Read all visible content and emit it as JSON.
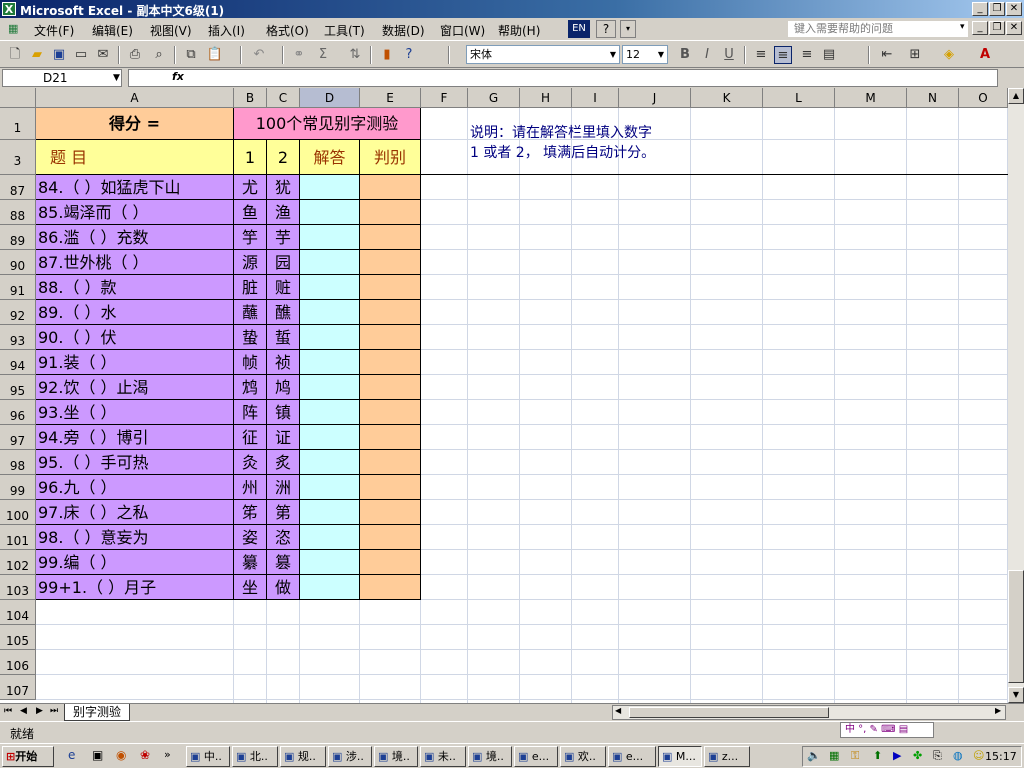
{
  "window": {
    "title": "Microsoft Excel - 副本中文6级(1)",
    "min": "_",
    "restore": "❐",
    "close": "✕"
  },
  "menu": {
    "items": [
      "文件(F)",
      "编辑(E)",
      "视图(V)",
      "插入(I)",
      "格式(O)",
      "工具(T)",
      "数据(D)",
      "窗口(W)",
      "帮助(H)"
    ],
    "lang": "EN",
    "help_placeholder": "键入需要帮助的问题"
  },
  "toolbar": {
    "font": "宋体",
    "size": "12",
    "bold": "B",
    "italic": "I",
    "underline": "U",
    "sum": "Σ"
  },
  "formula": {
    "namebox": "D21",
    "fx": "fx",
    "value": ""
  },
  "columns": [
    "A",
    "B",
    "C",
    "D",
    "E",
    "F",
    "G",
    "H",
    "I",
    "J",
    "K",
    "L",
    "M",
    "N",
    "O"
  ],
  "header": {
    "score_label": "得分 =",
    "test_title": "100个常见别字测验",
    "instr_line1": "说明：请在解答栏里填入数字",
    "instr_line2": "1 或者 2， 填满后自动计分。",
    "col_q": "题 目",
    "col_1": "1",
    "col_2": "2",
    "col_ans": "解答",
    "col_judge": "判别",
    "row1": "1",
    "row3": "3"
  },
  "rows": [
    {
      "n": "87",
      "q": "84.（ ）如猛虎下山",
      "c1": "尤",
      "c2": "犹"
    },
    {
      "n": "88",
      "q": "85.竭泽而（ ）",
      "c1": "鱼",
      "c2": "渔"
    },
    {
      "n": "89",
      "q": "86.滥（ ）充数",
      "c1": "竽",
      "c2": "芋"
    },
    {
      "n": "90",
      "q": "87.世外桃（ ）",
      "c1": "源",
      "c2": "园"
    },
    {
      "n": "91",
      "q": "88.（ ）款",
      "c1": "脏",
      "c2": "赃"
    },
    {
      "n": "92",
      "q": "89.（ ）水",
      "c1": "蘸",
      "c2": "醮"
    },
    {
      "n": "93",
      "q": "90.（ ）伏",
      "c1": "蛰",
      "c2": "蜇"
    },
    {
      "n": "94",
      "q": "91.装（ ）",
      "c1": "帧",
      "c2": "祯"
    },
    {
      "n": "95",
      "q": "92.饮（ ）止渴",
      "c1": "鸩",
      "c2": "鸠"
    },
    {
      "n": "96",
      "q": "93.坐（ ）",
      "c1": "阵",
      "c2": "镇"
    },
    {
      "n": "97",
      "q": "94.旁（ ）博引",
      "c1": "征",
      "c2": "证"
    },
    {
      "n": "98",
      "q": "95.（ ）手可热",
      "c1": "灸",
      "c2": "炙"
    },
    {
      "n": "99",
      "q": "96.九（ ）",
      "c1": "州",
      "c2": "洲"
    },
    {
      "n": "100",
      "q": "97.床（ ）之私",
      "c1": "笫",
      "c2": "第"
    },
    {
      "n": "101",
      "q": "98.（ ）意妄为",
      "c1": "姿",
      "c2": "恣"
    },
    {
      "n": "102",
      "q": "99.编（ ）",
      "c1": "纂",
      "c2": "篡"
    },
    {
      "n": "103",
      "q": "99+1.（ ）月子",
      "c1": "坐",
      "c2": "做"
    }
  ],
  "empty_rows": [
    "104",
    "105",
    "106",
    "107"
  ],
  "sheet_tab": "别字测验",
  "status": {
    "ready": "就绪"
  },
  "taskbar": {
    "start": "开始",
    "items": [
      "中..",
      "北..",
      "规..",
      "涉..",
      "境..",
      "未..",
      "境..",
      "e...",
      "欢..",
      "e...",
      "M...",
      "z..."
    ],
    "clock": "15:17"
  },
  "colors": {
    "score": "#FFCC99",
    "title": "#FF99CC",
    "question": "#CC99FF",
    "answer": "#CCFFFF",
    "judge": "#FFCC99",
    "header": "#FFFF99",
    "instr": "#000080"
  }
}
